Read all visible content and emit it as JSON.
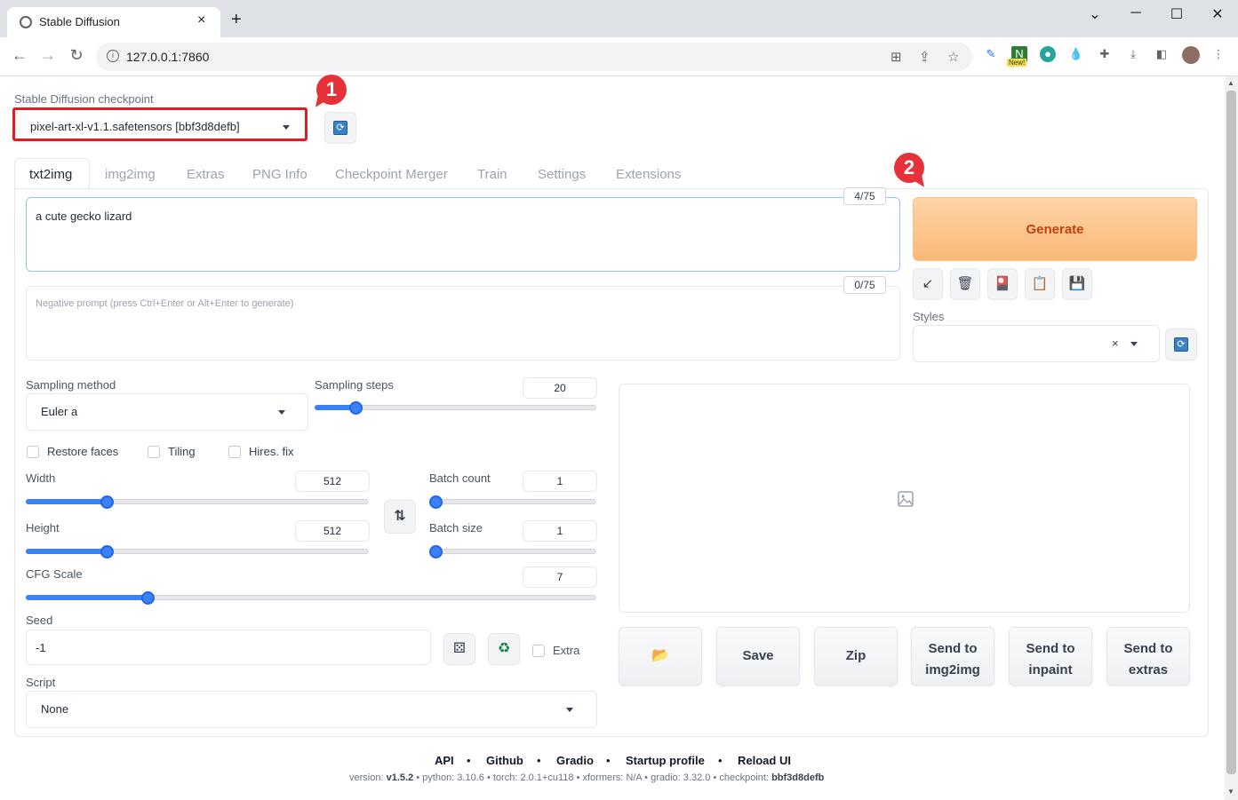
{
  "browser": {
    "tab_title": "Stable Diffusion",
    "tab_close": "×",
    "new_tab": "+",
    "url": "127.0.0.1:7860",
    "new_badge": "New!"
  },
  "webui": {
    "checkpoint_label": "Stable Diffusion checkpoint",
    "checkpoint_value": "pixel-art-xl-v1.1.safetensors [bbf3d8defb]",
    "annotations": [
      "1",
      "2"
    ],
    "tabs": [
      "txt2img",
      "img2img",
      "Extras",
      "PNG Info",
      "Checkpoint Merger",
      "Train",
      "Settings",
      "Extensions"
    ],
    "prompt": "a cute gecko lizard",
    "prompt_counter": "4/75",
    "negative_placeholder": "Negative prompt (press Ctrl+Enter or Alt+Enter to generate)",
    "negative_counter": "0/75",
    "generate_label": "Generate",
    "styles_label": "Styles",
    "styles_clear": "×",
    "sampling_method_label": "Sampling method",
    "sampling_method_value": "Euler a",
    "sampling_steps_label": "Sampling steps",
    "sampling_steps_value": "20",
    "restore_faces_label": "Restore faces",
    "tiling_label": "Tiling",
    "hires_label": "Hires. fix",
    "width_label": "Width",
    "width_value": "512",
    "height_label": "Height",
    "height_value": "512",
    "batch_count_label": "Batch count",
    "batch_count_value": "1",
    "batch_size_label": "Batch size",
    "batch_size_value": "1",
    "cfg_label": "CFG Scale",
    "cfg_value": "7",
    "seed_label": "Seed",
    "seed_value": "-1",
    "extra_label": "Extra",
    "script_label": "Script",
    "script_value": "None",
    "swap_icon": "⇅",
    "gallery_buttons": {
      "folder": "📂",
      "save": "Save",
      "zip": "Zip",
      "send_img2img_1": "Send to",
      "send_img2img_2": "img2img",
      "send_inpaint_1": "Send to",
      "send_inpaint_2": "inpaint",
      "send_extras_1": "Send to",
      "send_extras_2": "extras"
    },
    "footer_links": [
      "API",
      "Github",
      "Gradio",
      "Startup profile",
      "Reload UI"
    ],
    "footer_sep": "•",
    "version_line": {
      "version_label": "version: ",
      "version": "v1.5.2",
      "python": "python: 3.10.6",
      "torch": "torch: 2.0.1+cu118",
      "xformers": "xformers: N/A",
      "gradio": "gradio: 3.32.0",
      "checkpoint_label": "checkpoint: ",
      "checkpoint": "bbf3d8defb"
    }
  },
  "colors": {
    "accent": "#3b82f6",
    "generate": "#fbb877",
    "annotation": "#e53238"
  }
}
